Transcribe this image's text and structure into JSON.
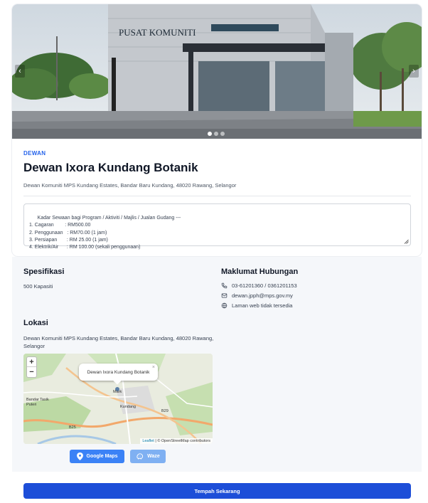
{
  "hero": {
    "sign_text": "PUSAT KOMUNITI",
    "prev_arrow": "‹",
    "next_arrow": "›",
    "slide_count": 3,
    "active_slide": 1
  },
  "venue": {
    "category": "DEWAN",
    "name": "Dewan Ixora Kundang Botanik",
    "address": "Dewan Komuniti MPS Kundang Estates, Bandar Baru Kundang, 48020 Rawang, Selangor",
    "description": "Kadar Sewaan bagi Program / Aktiviti / Majlis / Jualan Gudang ---\n1. Cagaran        : RM500.00\n2. Penggunaan   : RM70.00 (1 jam)\n3. Persiapan       : RM 25.00 (1 jam)\n4. Elektrik/Air      : RM 100.00 (sekali penggunaan)"
  },
  "spesifikasi": {
    "title": "Spesifikasi",
    "capacity": "500 Kapasiti"
  },
  "contact": {
    "title": "Maklumat Hubungan",
    "phone": "03-61201360 / 0361201153",
    "email": "dewan.jpph@mps.gov.my",
    "website": "Laman web tidak tersedia"
  },
  "location": {
    "title": "Lokasi",
    "address": "Dewan Komuniti MPS Kundang Estates, Bandar Baru Kundang, 48020 Rawang,\nSelangor",
    "map": {
      "zoom_in": "+",
      "zoom_out": "−",
      "popup_text": "Dewan Ixora Kundang Botanik",
      "popup_close": "×",
      "labels": [
        "Bandar Tasik Puteri",
        "Kundang",
        "Mark",
        "B29",
        "B25"
      ],
      "attribution_leaflet": "Leaflet",
      "attribution_rest": "| © OpenStreetMap contributors"
    },
    "google_maps_label": "Google Maps",
    "waze_label": "Waze"
  },
  "footer": {
    "book_label": "Tempah Sekarang"
  },
  "colors": {
    "accent": "#2563eb",
    "book_button": "#1d4ed8",
    "google_button": "#3b82f6",
    "waze_button": "#7fb0f2"
  }
}
